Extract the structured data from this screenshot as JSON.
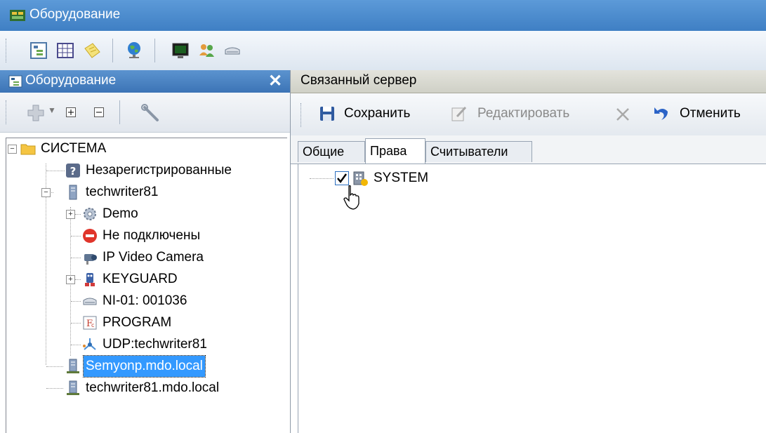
{
  "window": {
    "title": "Оборудование"
  },
  "toolbar": {
    "icons": [
      "tree-view-icon",
      "grid-icon",
      "notes-icon",
      "globe-icon",
      "monitor-icon",
      "users-icon",
      "device-icon"
    ]
  },
  "left_panel": {
    "title": "Оборудование",
    "close_glyph": "✕",
    "toolbar_icons": [
      "add-icon",
      "expand-all-icon",
      "collapse-all-icon",
      "wrench-icon"
    ]
  },
  "tree": {
    "root": "СИСТЕМА",
    "unregistered": "Незарегистрированные",
    "server1": "techwriter81",
    "demo": "Demo",
    "not_connected": "Не подключены",
    "camera": "IP Video Camera",
    "keyguard": "KEYGUARD",
    "ni": "NI-01: 001036",
    "program": "PROGRAM",
    "udp": "UDP:techwriter81",
    "server2": "Semyonp.mdo.local",
    "server3": "techwriter81.mdo.local"
  },
  "right_panel": {
    "title": "Связанный сервер",
    "toolbar": {
      "save": "Сохранить",
      "edit": "Редактировать",
      "cancel": "Отменить"
    },
    "tabs": [
      "Общие",
      "Права",
      "Считыватели"
    ],
    "active_tab": "Права",
    "rights_tree": {
      "item": "SYSTEM",
      "checked": true
    }
  },
  "colors": {
    "title_bar": "#3f7fc4",
    "selection": "#3399ff",
    "folder": "#f5c542"
  }
}
